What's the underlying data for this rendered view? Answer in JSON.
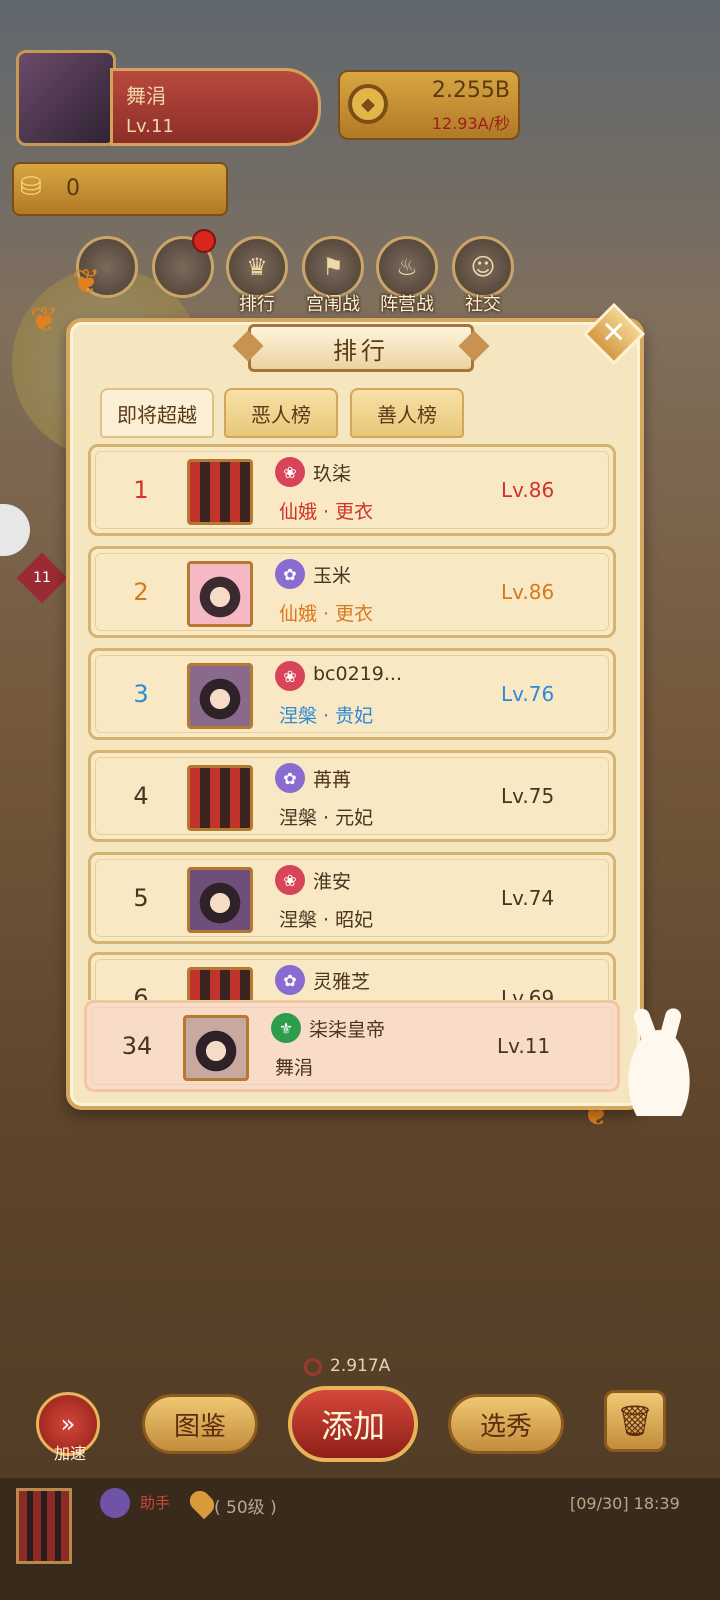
{
  "hud": {
    "player_name": "舞涓",
    "player_level": "Lv.11",
    "coins": "2.255B",
    "coin_rate": "12.93A/秒",
    "ingots": "0",
    "menu": [
      {
        "label": "排行",
        "icon": "trophy-icon"
      },
      {
        "label": "宫闱战",
        "icon": "war-flag-icon"
      },
      {
        "label": "阵营战",
        "icon": "camp-fire-icon"
      },
      {
        "label": "社交",
        "icon": "friends-icon"
      }
    ],
    "side_tag": "11"
  },
  "popup": {
    "title": "排行",
    "close_symbol": "✕",
    "tabs": [
      {
        "label": "即将超越",
        "active": true
      },
      {
        "label": "恶人榜",
        "active": false
      },
      {
        "label": "善人榜",
        "active": false
      }
    ],
    "rows": [
      {
        "rank": "1",
        "name": "玖柒",
        "title": "仙娥 · 更衣",
        "level": "Lv.86",
        "color": "#d0342c",
        "badge": "red"
      },
      {
        "rank": "2",
        "name": "玉米",
        "title": "仙娥 · 更衣",
        "level": "Lv.86",
        "color": "#d77a1e",
        "badge": "purple"
      },
      {
        "rank": "3",
        "name": "bc0219...",
        "title": "涅槃 · 贵妃",
        "level": "Lv.76",
        "color": "#2f8ad8",
        "badge": "red"
      },
      {
        "rank": "4",
        "name": "苒苒",
        "title": "涅槃 · 元妃",
        "level": "Lv.75",
        "color": "#4a3420",
        "badge": "purple"
      },
      {
        "rank": "5",
        "name": "淮安",
        "title": "涅槃 · 昭妃",
        "level": "Lv.74",
        "color": "#4a3420",
        "badge": "red"
      },
      {
        "rank": "6",
        "name": "灵雅芝",
        "title": "",
        "level": "Lv.69",
        "color": "#4a3420",
        "badge": "purple"
      }
    ],
    "self": {
      "rank": "34",
      "name": "柒柒皇帝",
      "title": "舞涓",
      "level": "Lv.11",
      "badge": "green"
    }
  },
  "bottom": {
    "cost": "2.917A",
    "speed_label": "加速",
    "catalog_label": "图鉴",
    "add_label": "添加",
    "select_label": "选秀",
    "status_name": "助手",
    "status_level": "( 50级 )",
    "status_time": "[09/30] 18:39"
  }
}
